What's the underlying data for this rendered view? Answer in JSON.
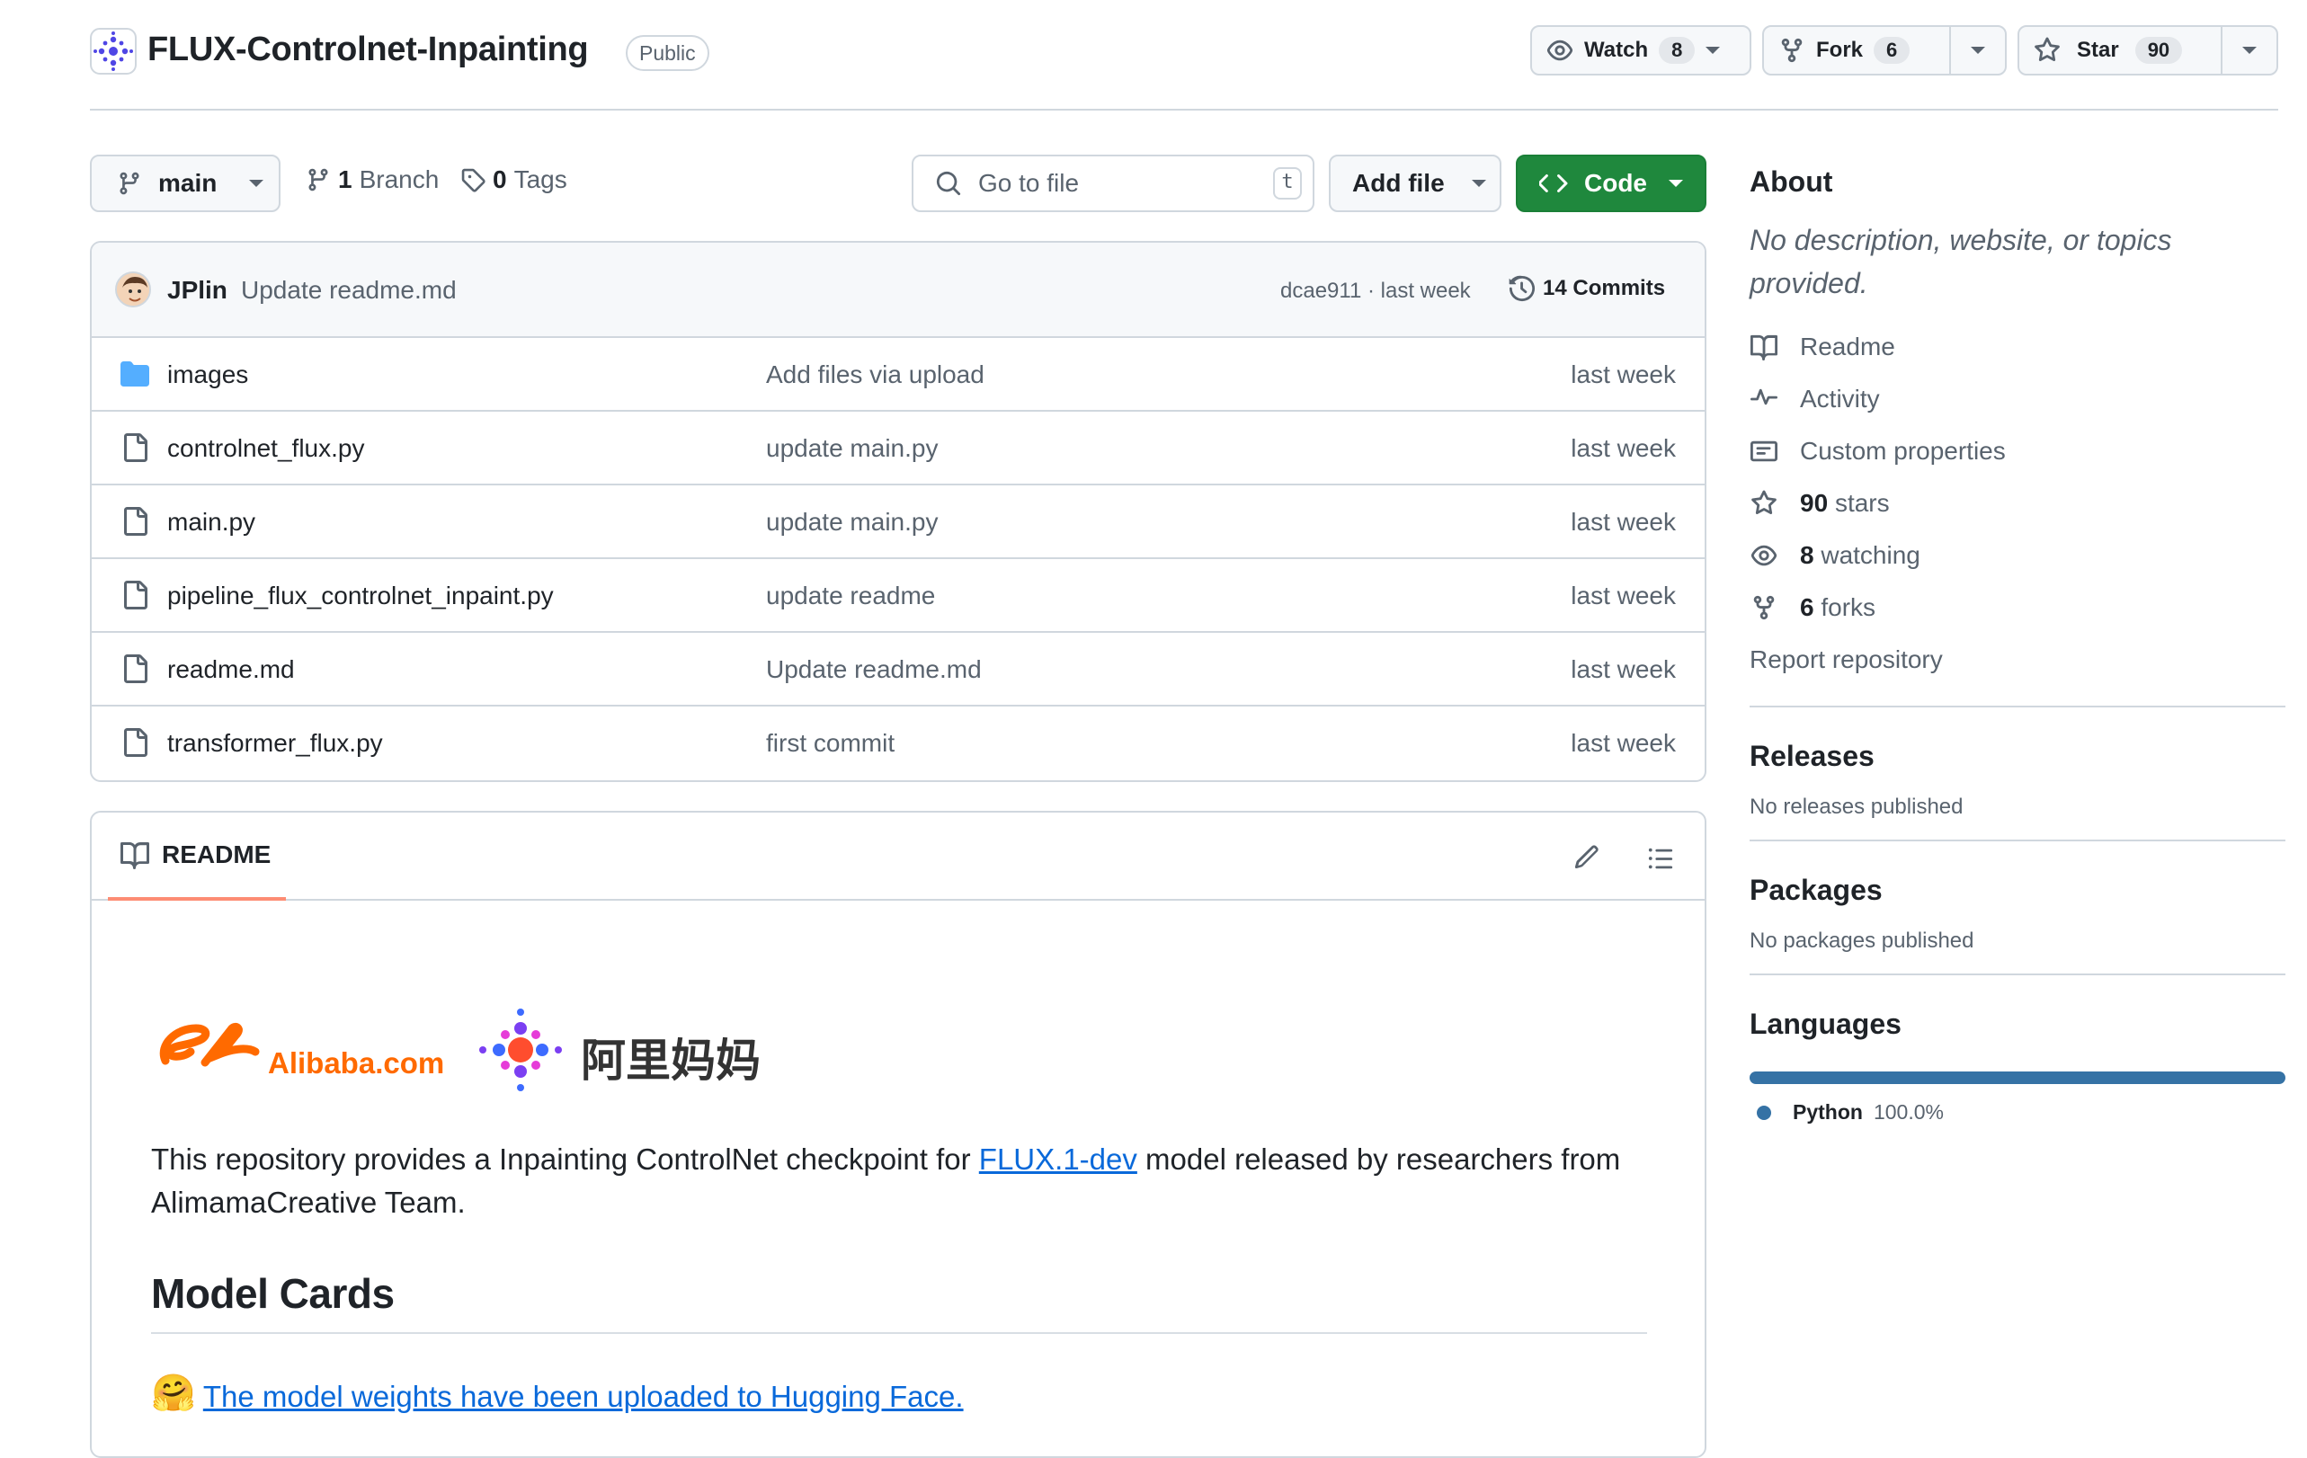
{
  "repo": {
    "name": "FLUX-Controlnet-Inpainting",
    "visibility": "Public",
    "watch_label": "Watch",
    "watch_count": "8",
    "fork_label": "Fork",
    "fork_count": "6",
    "star_label": "Star",
    "star_count": "90"
  },
  "toolbar": {
    "branch": "main",
    "branch_count": "1",
    "branch_label": "Branch",
    "tag_count": "0",
    "tag_label": "Tags",
    "search_placeholder": "Go to file",
    "search_shortcut": "t",
    "add_file_label": "Add file",
    "code_label": "Code"
  },
  "latest_commit": {
    "author": "JPlin",
    "message": "Update readme.md",
    "hash_and_time": "dcae911 · last week",
    "commits_label": "14 Commits"
  },
  "files": [
    {
      "name": "images",
      "type": "folder",
      "commit": "Add files via upload",
      "time": "last week"
    },
    {
      "name": "controlnet_flux.py",
      "type": "file",
      "commit": "update main.py",
      "time": "last week"
    },
    {
      "name": "main.py",
      "type": "file",
      "commit": "update main.py",
      "time": "last week"
    },
    {
      "name": "pipeline_flux_controlnet_inpaint.py",
      "type": "file",
      "commit": "update readme",
      "time": "last week"
    },
    {
      "name": "readme.md",
      "type": "file",
      "commit": "Update readme.md",
      "time": "last week"
    },
    {
      "name": "transformer_flux.py",
      "type": "file",
      "commit": "first commit",
      "time": "last week"
    }
  ],
  "readme": {
    "tab_label": "README",
    "logo_alibaba_text": "Alibaba.com",
    "logo_alimama_text": "阿里妈妈",
    "intro_before_link": "This repository provides a Inpainting ControlNet checkpoint for ",
    "intro_link": "FLUX.1-dev",
    "intro_after_link": " model released by researchers from AlimamaCreative Team.",
    "model_cards_heading": "Model Cards",
    "hf_emoji": "🤗",
    "hf_link": "The model weights have been uploaded to Hugging Face."
  },
  "sidebar": {
    "about_heading": "About",
    "about_description": "No description, website, or topics provided.",
    "readme_label": "Readme",
    "activity_label": "Activity",
    "custom_props_label": "Custom properties",
    "stars_count": "90",
    "stars_label": "stars",
    "watching_count": "8",
    "watching_label": "watching",
    "forks_count": "6",
    "forks_label": "forks",
    "report_label": "Report repository",
    "releases_heading": "Releases",
    "releases_text": "No releases published",
    "packages_heading": "Packages",
    "packages_text": "No packages published",
    "languages_heading": "Languages",
    "languages": [
      {
        "name": "Python",
        "percent": "100.0%",
        "color": "#3572a5"
      }
    ]
  },
  "colors": {
    "accent_green": "#1f883d",
    "link_blue": "#0969da",
    "tab_underline": "#fd8c73",
    "python": "#3572a5"
  }
}
